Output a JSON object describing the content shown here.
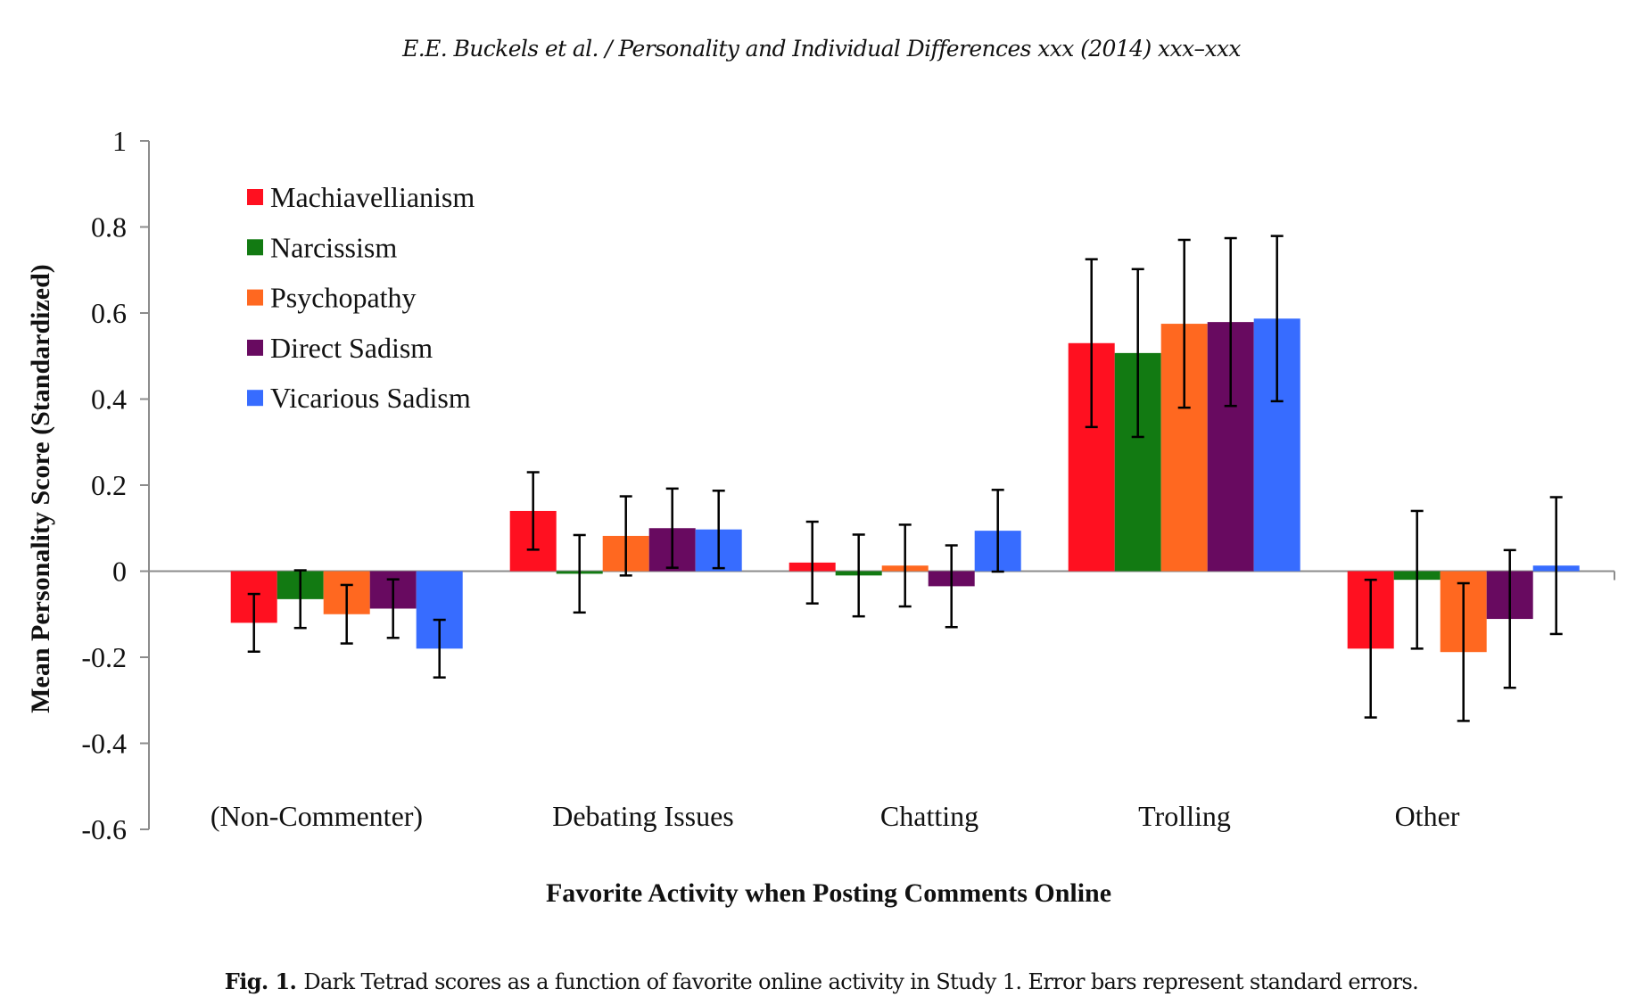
{
  "header": {
    "running_head": "E.E. Buckels et al. / Personality and Individual Differences xxx (2014) xxx–xxx"
  },
  "caption": {
    "label": "Fig. 1.",
    "text": "Dark Tetrad scores as a function of favorite online activity in Study 1. Error bars represent standard errors."
  },
  "chart_data": {
    "type": "bar",
    "title": "",
    "xlabel": "Favorite Activity when Posting Comments Online",
    "ylabel": "Mean Personality Score (Standardized)",
    "ylim": [
      -0.6,
      1.0
    ],
    "yticks": [
      1,
      0.8,
      0.6,
      0.4,
      0.2,
      0,
      -0.2,
      -0.4,
      -0.6
    ],
    "ytick_labels": [
      "1",
      "0.8",
      "0.6",
      "0.4",
      "0.2",
      "0",
      "-0.2",
      "-0.4",
      "-0.6"
    ],
    "grid": false,
    "legend_position": "top-left",
    "categories": [
      "(Non-Commenter)",
      "Debating Issues",
      "Chatting",
      "Trolling",
      "Other"
    ],
    "series": [
      {
        "name": "Machiavellianism",
        "color": "#FF1020",
        "values": [
          -0.12,
          0.14,
          0.02,
          0.53,
          -0.18
        ],
        "errors": [
          0.067,
          0.09,
          0.095,
          0.195,
          0.16
        ]
      },
      {
        "name": "Narcissism",
        "color": "#127A12",
        "values": [
          -0.065,
          -0.006,
          -0.01,
          0.507,
          -0.02
        ],
        "errors": [
          0.067,
          0.09,
          0.095,
          0.195,
          0.16
        ]
      },
      {
        "name": "Psychopathy",
        "color": "#FF6820",
        "values": [
          -0.1,
          0.082,
          0.013,
          0.575,
          -0.188
        ],
        "errors": [
          0.068,
          0.092,
          0.095,
          0.195,
          0.16
        ]
      },
      {
        "name": "Direct Sadism",
        "color": "#680A60",
        "values": [
          -0.087,
          0.1,
          -0.035,
          0.579,
          -0.111
        ],
        "errors": [
          0.068,
          0.092,
          0.095,
          0.195,
          0.16
        ]
      },
      {
        "name": "Vicarious Sadism",
        "color": "#376CFF",
        "values": [
          -0.18,
          0.097,
          0.094,
          0.587,
          0.013
        ],
        "errors": [
          0.067,
          0.09,
          0.095,
          0.192,
          0.159
        ]
      }
    ]
  }
}
